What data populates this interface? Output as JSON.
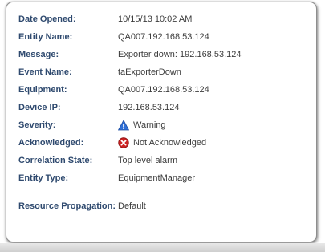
{
  "details": {
    "rows": [
      {
        "label": "Date Opened:",
        "value": "10/15/13 10:02 AM"
      },
      {
        "label": "Entity Name:",
        "value": "QA007.192.168.53.124"
      },
      {
        "label": "Message:",
        "value": "Exporter down: 192.168.53.124"
      },
      {
        "label": "Event Name:",
        "value": "taExporterDown"
      },
      {
        "label": "Equipment:",
        "value": "QA007.192.168.53.124"
      },
      {
        "label": "Device IP:",
        "value": "192.168.53.124"
      },
      {
        "label": "Severity:",
        "value": "Warning",
        "icon": "warning-triangle-icon"
      },
      {
        "label": "Acknowledged:",
        "value": "Not Acknowledged",
        "icon": "not-acknowledged-icon"
      },
      {
        "label": "Correlation State:",
        "value": "Top level alarm"
      },
      {
        "label": "Entity Type:",
        "value": "EquipmentManager"
      },
      {
        "label": "Resource Propagation:",
        "value": "Default"
      }
    ]
  },
  "colors": {
    "label": "#2f4a6f",
    "value": "#3d3d3d",
    "warning_icon": "#2f6fd6",
    "not_ack_icon": "#cc2222"
  }
}
